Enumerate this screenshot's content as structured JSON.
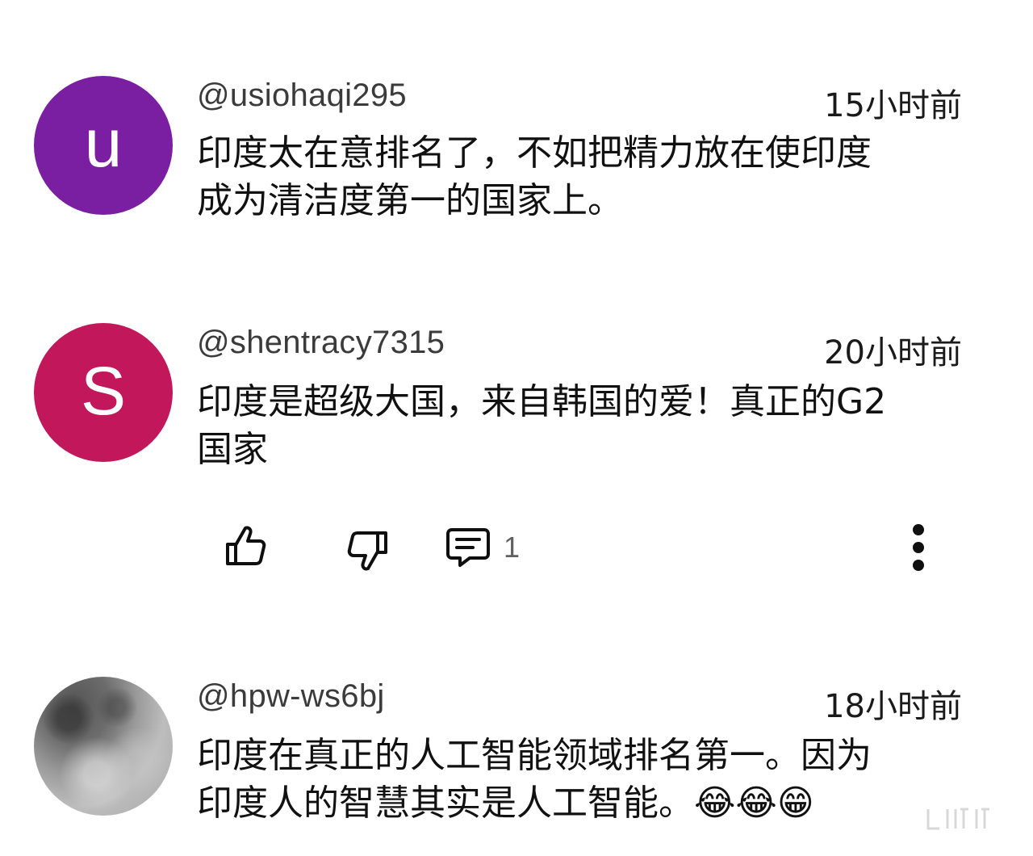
{
  "comments": [
    {
      "avatar_letter": "u",
      "avatar_color": "#7b1fa2",
      "username": "@usiohaqi295",
      "time": "15小时前",
      "lines": [
        "印度太在意排名了，不如把精力放在使印度",
        "成为清洁度第一的国家上。"
      ]
    },
    {
      "avatar_letter": "S",
      "avatar_color": "#c2185b",
      "username": "@shentracy7315",
      "time": "20小时前",
      "lines": [
        "印度是超级大国，来自韩国的爱！真正的G2",
        "国家"
      ]
    },
    {
      "avatar_letter": "",
      "username": "@hpw-ws6bj",
      "time": "18小时前",
      "lines": [
        "印度在真正的人工智能领域排名第一。因为",
        "印度人的智慧其实是人工智能。😂😂😁"
      ]
    }
  ],
  "actions": {
    "reply_count": "1",
    "like_icon": "thumbs-up-icon",
    "dislike_icon": "thumbs-down-icon",
    "reply_icon": "comment-icon",
    "more_icon": "more-vert-icon"
  }
}
